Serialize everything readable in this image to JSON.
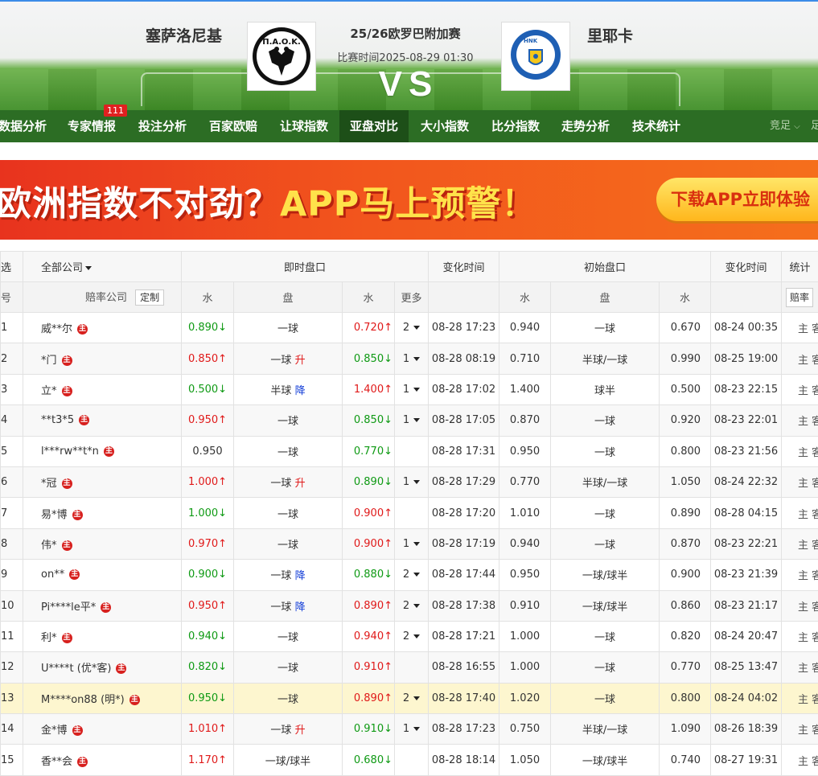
{
  "match": {
    "home": "塞萨洛尼基",
    "away": "里耶卡",
    "competition": "25/26欧罗巴附加赛",
    "time": "比赛时间2025-08-29 01:30",
    "vs": "VS",
    "home_logo_text": "Π.Α.Ο.Κ.",
    "away_logo_text": "HNK RIJEKA"
  },
  "nav": {
    "items": [
      "数据分析",
      "专家情报",
      "投注分析",
      "百家欧赔",
      "让球指数",
      "亚盘对比",
      "大小指数",
      "比分指数",
      "走势分析",
      "技术统计"
    ],
    "active_index": 5,
    "badge": "111",
    "right_label": "竞足",
    "right_label2": "足"
  },
  "banner": {
    "text_part1": "欧洲指数不对劲？",
    "text_part2": "APP马上预警！",
    "button": "下载APP立即体验"
  },
  "table": {
    "header1": {
      "select": "选",
      "company_filter": "全部公司",
      "live": "即时盘口",
      "change_time": "变化时间",
      "initial": "初始盘口",
      "change_time2": "变化时间",
      "stats": "统计"
    },
    "header2": {
      "num": "号",
      "company": "赔率公司",
      "custom": "定制",
      "water": "水",
      "handicap": "盘",
      "water2": "水",
      "more": "更多",
      "init_water": "水",
      "init_handicap": "盘",
      "init_water2": "水",
      "stats_select": "赔率"
    },
    "main_badge": "主",
    "home_away": "主 客",
    "rows": [
      {
        "n": "1",
        "company": "威**尔",
        "w1": "0.890",
        "w1d": "down",
        "h": "一球",
        "hc": "",
        "w2": "0.720",
        "w2d": "up",
        "more": "2",
        "time": "08-28 17:23",
        "iw1": "0.940",
        "ih": "一球",
        "iw2": "0.670",
        "itime": "08-24 00:35"
      },
      {
        "n": "2",
        "company": "*门",
        "w1": "0.850",
        "w1d": "up",
        "h": "一球",
        "hc": "升",
        "w2": "0.850",
        "w2d": "down",
        "more": "1",
        "time": "08-28 08:19",
        "iw1": "0.710",
        "ih": "半球/一球",
        "iw2": "0.990",
        "itime": "08-25 19:00"
      },
      {
        "n": "3",
        "company": "立*",
        "w1": "0.500",
        "w1d": "down",
        "h": "半球",
        "hc": "降",
        "w2": "1.400",
        "w2d": "up",
        "more": "1",
        "time": "08-28 17:02",
        "iw1": "1.400",
        "ih": "球半",
        "iw2": "0.500",
        "itime": "08-23 22:15"
      },
      {
        "n": "4",
        "company": "**t3*5",
        "w1": "0.950",
        "w1d": "up",
        "h": "一球",
        "hc": "",
        "w2": "0.850",
        "w2d": "down",
        "more": "1",
        "time": "08-28 17:05",
        "iw1": "0.870",
        "ih": "一球",
        "iw2": "0.920",
        "itime": "08-23 22:01"
      },
      {
        "n": "5",
        "company": "l***rw**t*n",
        "w1": "0.950",
        "w1d": "flat",
        "h": "一球",
        "hc": "",
        "w2": "0.770",
        "w2d": "down",
        "more": "",
        "time": "08-28 17:31",
        "iw1": "0.950",
        "ih": "一球",
        "iw2": "0.800",
        "itime": "08-23 21:56"
      },
      {
        "n": "6",
        "company": "*冠",
        "w1": "1.000",
        "w1d": "up",
        "h": "一球",
        "hc": "升",
        "w2": "0.890",
        "w2d": "down",
        "more": "1",
        "time": "08-28 17:29",
        "iw1": "0.770",
        "ih": "半球/一球",
        "iw2": "1.050",
        "itime": "08-24 22:32"
      },
      {
        "n": "7",
        "company": "易*博",
        "w1": "1.000",
        "w1d": "down",
        "h": "一球",
        "hc": "",
        "w2": "0.900",
        "w2d": "up",
        "more": "",
        "time": "08-28 17:20",
        "iw1": "1.010",
        "ih": "一球",
        "iw2": "0.890",
        "itime": "08-28 04:15"
      },
      {
        "n": "8",
        "company": "伟*",
        "w1": "0.970",
        "w1d": "up",
        "h": "一球",
        "hc": "",
        "w2": "0.900",
        "w2d": "up",
        "more": "1",
        "time": "08-28 17:19",
        "iw1": "0.940",
        "ih": "一球",
        "iw2": "0.870",
        "itime": "08-23 22:21"
      },
      {
        "n": "9",
        "company": "on**",
        "w1": "0.900",
        "w1d": "down",
        "h": "一球",
        "hc": "降",
        "w2": "0.880",
        "w2d": "down",
        "more": "2",
        "time": "08-28 17:44",
        "iw1": "0.950",
        "ih": "一球/球半",
        "iw2": "0.900",
        "itime": "08-23 21:39"
      },
      {
        "n": "10",
        "company": "Pi****le平*",
        "w1": "0.950",
        "w1d": "up",
        "h": "一球",
        "hc": "降",
        "w2": "0.890",
        "w2d": "up",
        "more": "2",
        "time": "08-28 17:38",
        "iw1": "0.910",
        "ih": "一球/球半",
        "iw2": "0.860",
        "itime": "08-23 21:17"
      },
      {
        "n": "11",
        "company": "利*",
        "w1": "0.940",
        "w1d": "down",
        "h": "一球",
        "hc": "",
        "w2": "0.940",
        "w2d": "up",
        "more": "2",
        "time": "08-28 17:21",
        "iw1": "1.000",
        "ih": "一球",
        "iw2": "0.820",
        "itime": "08-24 20:47"
      },
      {
        "n": "12",
        "company": "U****t (优*客)",
        "w1": "0.820",
        "w1d": "down",
        "h": "一球",
        "hc": "",
        "w2": "0.910",
        "w2d": "up",
        "more": "",
        "time": "08-28 16:55",
        "iw1": "1.000",
        "ih": "一球",
        "iw2": "0.770",
        "itime": "08-25 13:47"
      },
      {
        "n": "13",
        "company": "M****on88 (明*)",
        "w1": "0.950",
        "w1d": "down",
        "h": "一球",
        "hc": "",
        "w2": "0.890",
        "w2d": "up",
        "more": "2",
        "time": "08-28 17:40",
        "iw1": "1.020",
        "ih": "一球",
        "iw2": "0.800",
        "itime": "08-24 04:02",
        "highlight": true
      },
      {
        "n": "14",
        "company": "金*博",
        "w1": "1.010",
        "w1d": "up",
        "h": "一球",
        "hc": "升",
        "w2": "0.910",
        "w2d": "down",
        "more": "1",
        "time": "08-28 17:23",
        "iw1": "0.750",
        "ih": "半球/一球",
        "iw2": "1.090",
        "itime": "08-26 18:39"
      },
      {
        "n": "15",
        "company": "香**会",
        "w1": "1.170",
        "w1d": "up",
        "h": "一球/球半",
        "hc": "",
        "w2": "0.680",
        "w2d": "down",
        "more": "",
        "time": "08-28 18:14",
        "iw1": "1.050",
        "ih": "一球/球半",
        "iw2": "0.740",
        "itime": "08-27 19:31"
      }
    ]
  }
}
